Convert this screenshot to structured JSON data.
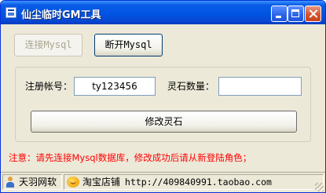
{
  "window": {
    "title": "仙尘临时GM工具"
  },
  "toolbar": {
    "connect_label": "连接Mysql",
    "disconnect_label": "断开Mysql"
  },
  "form": {
    "account_label": "注册帐号：",
    "account_value": "ty123456",
    "stone_label": "灵石数量：",
    "stone_value": "",
    "modify_label": "修改灵石"
  },
  "notice": "注意：请先连接Mysql数据库，修改成功后请从新登陆角色；",
  "statusbar": {
    "panel1_text": "天羽网软",
    "panel2_text": "淘宝店铺",
    "panel2_url": "http://409840991.taobao.com"
  },
  "colors": {
    "titlebar": "#0054e3",
    "notice": "#ff0000",
    "window_bg": "#ece9d8"
  }
}
